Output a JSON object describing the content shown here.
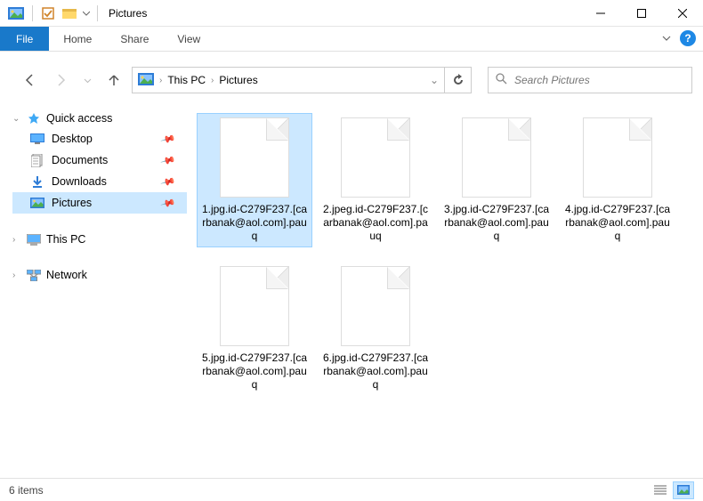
{
  "window": {
    "title": "Pictures"
  },
  "ribbon": {
    "file": "File",
    "tabs": [
      "Home",
      "Share",
      "View"
    ]
  },
  "breadcrumb": {
    "root": "This PC",
    "current": "Pictures"
  },
  "search": {
    "placeholder": "Search Pictures"
  },
  "navpane": {
    "quick_access": {
      "label": "Quick access",
      "items": [
        {
          "label": "Desktop",
          "icon": "desktop"
        },
        {
          "label": "Documents",
          "icon": "documents"
        },
        {
          "label": "Downloads",
          "icon": "downloads"
        },
        {
          "label": "Pictures",
          "icon": "pictures",
          "selected": true
        }
      ]
    },
    "this_pc": {
      "label": "This PC"
    },
    "network": {
      "label": "Network"
    }
  },
  "files": [
    {
      "name": "1.jpg.id-C279F237.[carbanak@aol.com].pauq",
      "selected": true
    },
    {
      "name": "2.jpeg.id-C279F237.[carbanak@aol.com].pauq"
    },
    {
      "name": "3.jpg.id-C279F237.[carbanak@aol.com].pauq"
    },
    {
      "name": "4.jpg.id-C279F237.[carbanak@aol.com].pauq"
    },
    {
      "name": "5.jpg.id-C279F237.[carbanak@aol.com].pauq"
    },
    {
      "name": "6.jpg.id-C279F237.[carbanak@aol.com].pauq"
    }
  ],
  "status": {
    "count_label": "6 items"
  }
}
